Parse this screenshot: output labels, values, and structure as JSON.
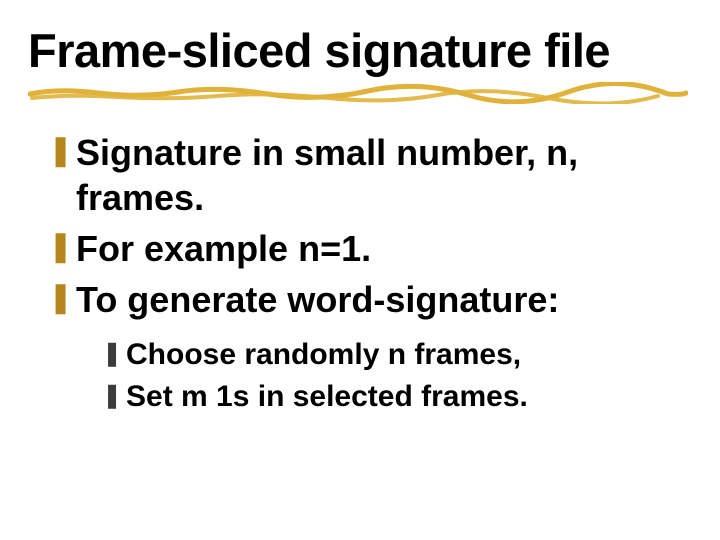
{
  "title": "Frame-sliced signature file",
  "bullets": {
    "lvl1": [
      {
        "glyph": "❚",
        "text": "Signature in small number, n, frames."
      },
      {
        "glyph": "❚",
        "text": "For example n=1."
      },
      {
        "glyph": "❚",
        "text": "To generate word-signature:"
      }
    ],
    "lvl2": [
      {
        "glyph": "❚",
        "text": "Choose randomly n frames,"
      },
      {
        "glyph": "❚",
        "text": "Set m 1s in selected frames."
      }
    ]
  },
  "colors": {
    "underline": "#e0b23a",
    "lvl1_bullet": "#b6861e",
    "lvl2_bullet": "#3b3b3b"
  }
}
